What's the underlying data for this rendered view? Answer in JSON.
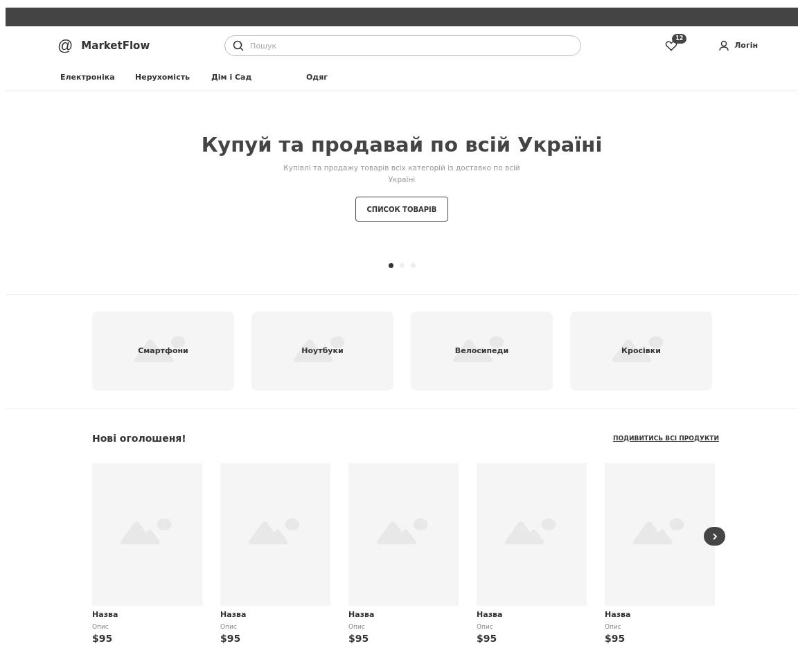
{
  "brand": {
    "logo": "@",
    "name": "MarketFlow"
  },
  "search": {
    "placeholder": "Пошук"
  },
  "favorites": {
    "count": "12"
  },
  "login": {
    "label": "Логін"
  },
  "nav": [
    "Електроніка",
    "Нерухомість",
    "Дім і Сад",
    "Одяг"
  ],
  "hero": {
    "title": "Купуй та продавай по всій Україні",
    "subtitle": "Купівлі та продажу товарів всіх категорій із доставко по всій Україні",
    "button": "СПИСОК ТОВАРІВ",
    "dots": [
      {
        "selected": true
      },
      {
        "selected": false
      },
      {
        "selected": false
      }
    ]
  },
  "categories": [
    "Смартфони",
    "Ноутбуки",
    "Велосипеди",
    "Кросівки"
  ],
  "new_listings": {
    "title": "Нові оголошеня!",
    "view_all": "ПОДИВИТИСЬ ВСІ ПРОДУКТИ",
    "products": [
      {
        "name": "Назва",
        "description": "Опис",
        "price": "$95"
      },
      {
        "name": "Назва",
        "description": "Опис",
        "price": "$95"
      },
      {
        "name": "Назва",
        "description": "Опис",
        "price": "$95"
      },
      {
        "name": "Назва",
        "description": "Опис",
        "price": "$95"
      },
      {
        "name": "Назва",
        "description": "Опис",
        "price": "$95"
      }
    ]
  }
}
